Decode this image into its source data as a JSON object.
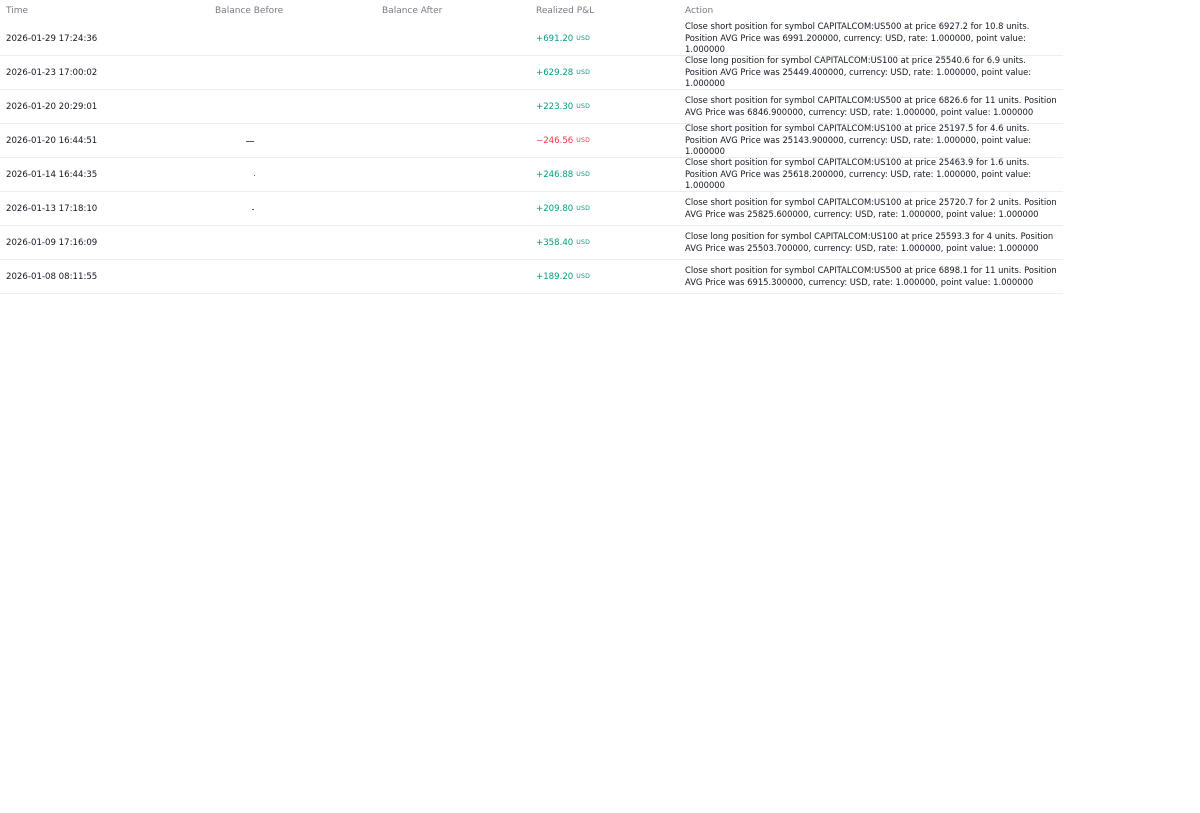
{
  "colors": {
    "positive": "#089981",
    "negative": "#f23645",
    "header_text": "#787b86",
    "row_border": "#eceff2"
  },
  "columns": {
    "time": "Time",
    "balance_before": "Balance Before",
    "balance_after": "Balance After",
    "realized_pnl": "Realized P&L",
    "action": "Action"
  },
  "rows": [
    {
      "time": "2026-01-29 17:24:36",
      "balance_before": "",
      "balance_after": "",
      "pnl": "+691.20",
      "pnl_unit": "USD",
      "pnl_sign": "positive",
      "action": "Close short position for symbol CAPITALCOM:US500 at price 6927.2 for 10.8 units. Position AVG Price was 6991.200000, currency: USD, rate: 1.000000, point value: 1.000000"
    },
    {
      "time": "2026-01-23 17:00:02",
      "balance_before": "",
      "balance_after": "",
      "pnl": "+629.28",
      "pnl_unit": "USD",
      "pnl_sign": "positive",
      "action": "Close long position for symbol CAPITALCOM:US100 at price 25540.6 for 6.9 units. Position AVG Price was 25449.400000, currency: USD, rate: 1.000000, point value: 1.000000"
    },
    {
      "time": "2026-01-20 20:29:01",
      "balance_before": "",
      "balance_after": "",
      "pnl": "+223.30",
      "pnl_unit": "USD",
      "pnl_sign": "positive",
      "action": "Close short position for symbol CAPITALCOM:US500 at price 6826.6 for 11 units. Position AVG Price was 6846.900000, currency: USD, rate: 1.000000, point value: 1.000000"
    },
    {
      "time": "2026-01-20 16:44:51",
      "balance_before": "",
      "balance_after": "",
      "pnl": "−246.56",
      "pnl_unit": "USD",
      "pnl_sign": "negative",
      "action": "Close short position for symbol CAPITALCOM:US100 at price 25197.5 for 4.6 units. Position AVG Price was 25143.900000, currency: USD, rate: 1.000000, point value: 1.000000"
    },
    {
      "time": "2026-01-14 16:44:35",
      "balance_before": "",
      "balance_after": "",
      "pnl": "+246.88",
      "pnl_unit": "USD",
      "pnl_sign": "positive",
      "action": "Close short position for symbol CAPITALCOM:US100 at price 25463.9 for 1.6 units. Position AVG Price was 25618.200000, currency: USD, rate: 1.000000, point value: 1.000000"
    },
    {
      "time": "2026-01-13 17:18:10",
      "balance_before": "",
      "balance_after": "",
      "pnl": "+209.80",
      "pnl_unit": "USD",
      "pnl_sign": "positive",
      "action": "Close short position for symbol CAPITALCOM:US100 at price 25720.7 for 2 units. Position AVG Price was 25825.600000, currency: USD, rate: 1.000000, point value: 1.000000"
    },
    {
      "time": "2026-01-09 17:16:09",
      "balance_before": "",
      "balance_after": "",
      "pnl": "+358.40",
      "pnl_unit": "USD",
      "pnl_sign": "positive",
      "action": "Close long position for symbol CAPITALCOM:US100 at price 25593.3 for 4 units. Position AVG Price was 25503.700000, currency: USD, rate: 1.000000, point value: 1.000000"
    },
    {
      "time": "2026-01-08 08:11:55",
      "balance_before": "",
      "balance_after": "",
      "pnl": "+189.20",
      "pnl_unit": "USD",
      "pnl_sign": "positive",
      "action": "Close short position for symbol CAPITALCOM:US500 at price 6898.1 for 11 units. Position AVG Price was 6915.300000, currency: USD, rate: 1.000000, point value: 1.000000"
    }
  ]
}
